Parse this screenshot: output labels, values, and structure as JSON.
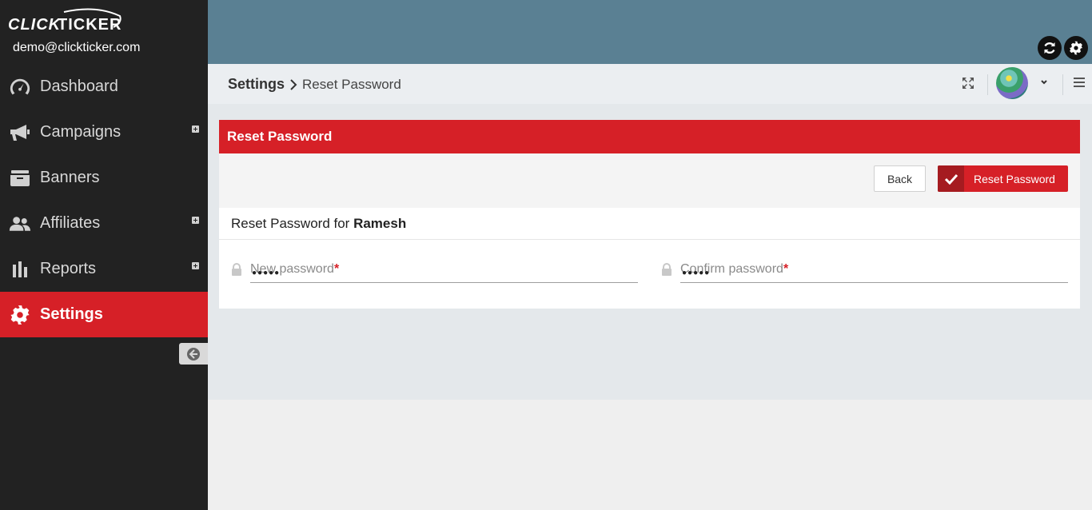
{
  "app": {
    "logo_text": "CLICK TICKER",
    "user_email": "demo@clickticker.com"
  },
  "sidebar": {
    "items": [
      {
        "label": "Dashboard",
        "icon": "dashboard-icon",
        "expandable": false,
        "active": false
      },
      {
        "label": "Campaigns",
        "icon": "megaphone-icon",
        "expandable": true,
        "active": false
      },
      {
        "label": "Banners",
        "icon": "archive-icon",
        "expandable": false,
        "active": false
      },
      {
        "label": "Affiliates",
        "icon": "users-icon",
        "expandable": true,
        "active": false
      },
      {
        "label": "Reports",
        "icon": "bar-chart-icon",
        "expandable": true,
        "active": false
      },
      {
        "label": "Settings",
        "icon": "gear-icon",
        "expandable": false,
        "active": true
      }
    ]
  },
  "breadcrumb": {
    "parent": "Settings",
    "current": "Reset Password"
  },
  "panel": {
    "title": "Reset Password",
    "back_label": "Back",
    "submit_label": "Reset Password",
    "form_title_prefix": "Reset Password for",
    "form_title_user": "Ramesh"
  },
  "fields": {
    "new_password": {
      "placeholder": "New password",
      "required_mark": "*",
      "masked_value": "●●●●●"
    },
    "confirm_password": {
      "placeholder": "Confirm password",
      "required_mark": "*",
      "masked_value": "●●●●●"
    }
  },
  "colors": {
    "accent": "#d62027",
    "sidebar_bg": "#222222",
    "topbar_bg": "#5a8093"
  }
}
